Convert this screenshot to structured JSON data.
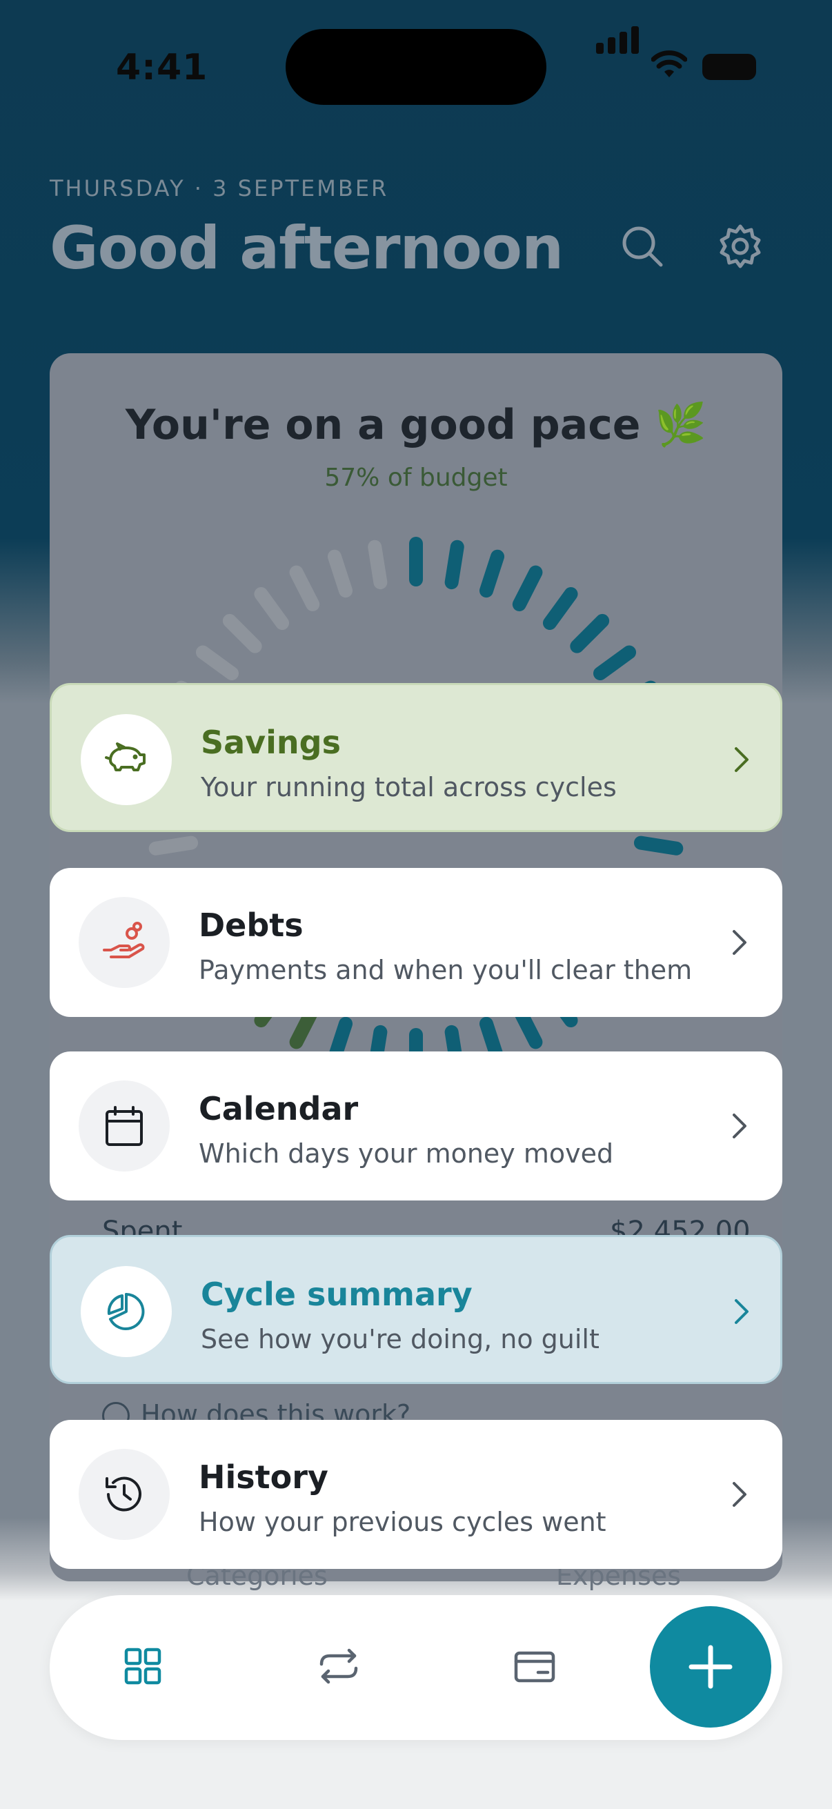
{
  "status_bar": {
    "time": "4:41"
  },
  "header": {
    "date": "THURSDAY · 3 SEPTEMBER",
    "greeting": "Good afternoon"
  },
  "pace_card": {
    "title": "You're on a good pace 🌿",
    "subtitle": "57% of budget",
    "budget_used_fraction": 0.57,
    "spent_label": "Spent",
    "spent_value": "$2,452.00",
    "help_link": "How does this work?",
    "bottom_tabs": [
      "Categories",
      "Expenses"
    ]
  },
  "menu": [
    {
      "title": "Savings",
      "subtitle": "Your running total across cycles",
      "icon": "piggy-bank-icon",
      "accent": "#4a6e22"
    },
    {
      "title": "Debts",
      "subtitle": "Payments and when you'll clear them",
      "icon": "hand-coins-icon",
      "accent": "#d9544a"
    },
    {
      "title": "Calendar",
      "subtitle": "Which days your money moved",
      "icon": "calendar-icon",
      "accent": "#1b1f24"
    },
    {
      "title": "Cycle summary",
      "subtitle": "See how you're doing, no guilt",
      "icon": "pie-chart-icon",
      "accent": "#19859a"
    },
    {
      "title": "History",
      "subtitle": "How your previous cycles went",
      "icon": "history-icon",
      "accent": "#1b1f24"
    }
  ],
  "bottom_nav": {
    "items": [
      "dashboard-icon",
      "repeat-icon",
      "card-icon"
    ],
    "fab": "plus-icon",
    "active_color": "#0f8aa0"
  }
}
